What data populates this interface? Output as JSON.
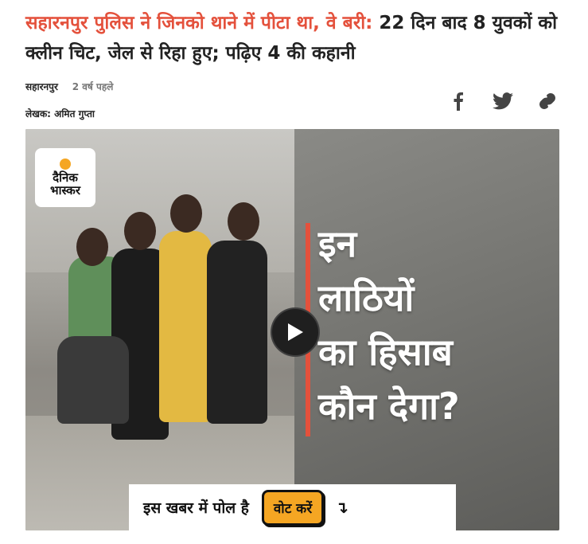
{
  "article": {
    "headline_kicker": "सहारनपुर पुलिस ने जिनको थाने में पीटा था, वे बरी:",
    "headline_rest": " 22 दिन बाद 8 युवकों को क्लीन चिट, जेल से रिहा हुए; पढ़िए 4 की कहानी",
    "city": "सहारनपुर",
    "time": "2 वर्ष पहले",
    "author": "लेखक: अमित गुप्ता"
  },
  "share": {
    "icons": [
      "facebook-icon",
      "twitter-icon",
      "link-icon"
    ]
  },
  "video": {
    "logo_line1": "दैनिक",
    "logo_line2": "भास्कर",
    "overlay_lines": [
      "इन",
      "लाठियों",
      "का हिसाब",
      "कौन देगा?"
    ]
  },
  "poll": {
    "text": "इस खबर में पोल है",
    "button_label": "वोट करें",
    "arrow": "↴"
  },
  "colors": {
    "accent": "#e4513c",
    "vote_button": "#f5a623"
  }
}
